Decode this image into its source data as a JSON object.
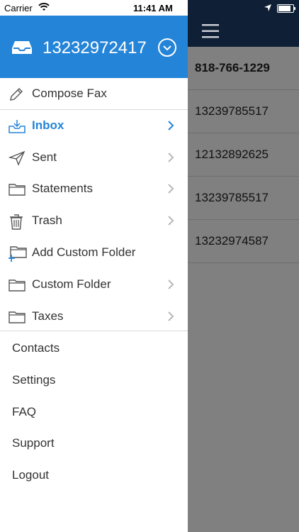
{
  "status": {
    "carrier": "Carrier",
    "time": "11:41 AM",
    "battery_level": 0.85
  },
  "drawer": {
    "account_number": "13232972417",
    "folders": [
      {
        "label": "Compose Fax",
        "icon": "pencil-icon",
        "chevron": false,
        "active": false
      },
      {
        "label": "Inbox",
        "icon": "inbox-icon",
        "chevron": true,
        "active": true
      },
      {
        "label": "Sent",
        "icon": "paper-plane-icon",
        "chevron": true,
        "active": false
      },
      {
        "label": "Statements",
        "icon": "folder-icon",
        "chevron": true,
        "active": false
      },
      {
        "label": "Trash",
        "icon": "trash-icon",
        "chevron": true,
        "active": false
      },
      {
        "label": "Add Custom Folder",
        "icon": "add-folder-icon",
        "chevron": false,
        "active": false
      },
      {
        "label": "Custom Folder",
        "icon": "folder-icon",
        "chevron": true,
        "active": false
      },
      {
        "label": "Taxes",
        "icon": "folder-icon",
        "chevron": true,
        "active": false
      }
    ],
    "links": [
      "Contacts",
      "Settings",
      "FAQ",
      "Support",
      "Logout"
    ]
  },
  "background": {
    "rows": [
      "818-766-1229",
      "13239785517",
      "12132892625",
      "13239785517",
      "13232974587"
    ]
  },
  "colors": {
    "accent": "#2484d8",
    "header_dark": "#0f1f35",
    "overlay": "#808080"
  }
}
